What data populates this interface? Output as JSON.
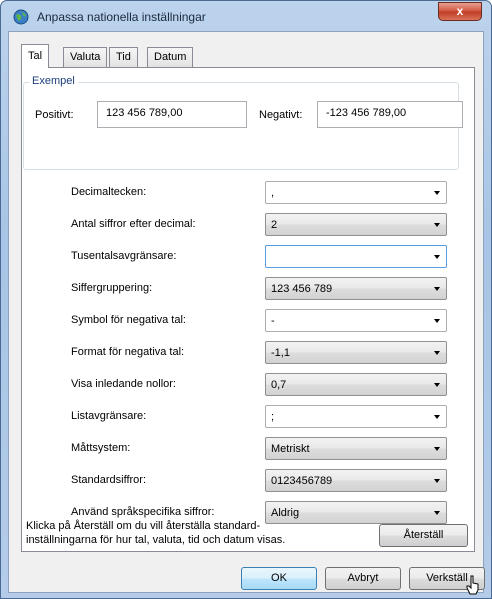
{
  "window": {
    "title": "Anpassa nationella inställningar",
    "close_label": "x"
  },
  "tabs": [
    "Tal",
    "Valuta",
    "Tid",
    "Datum"
  ],
  "example": {
    "legend": "Exempel",
    "positive_label": "Positivt:",
    "positive_value": "123 456 789,00",
    "negative_label": "Negativt:",
    "negative_value": "-123 456 789,00"
  },
  "settings": [
    {
      "label": "Decimaltecken:",
      "value": ","
    },
    {
      "label": "Antal siffror efter decimal:",
      "value": "2"
    },
    {
      "label": "Tusentalsavgränsare:",
      "value": ""
    },
    {
      "label": "Siffergruppering:",
      "value": "123 456 789"
    },
    {
      "label": "Symbol för negativa tal:",
      "value": "-"
    },
    {
      "label": "Format för negativa tal:",
      "value": "-1,1"
    },
    {
      "label": "Visa inledande nollor:",
      "value": "0,7"
    },
    {
      "label": "Listavgränsare:",
      "value": ";"
    },
    {
      "label": "Måttsystem:",
      "value": "Metriskt"
    },
    {
      "label": "Standardsiffror:",
      "value": "0123456789"
    },
    {
      "label": "Använd språkspecifika siffror:",
      "value": "Aldrig"
    }
  ],
  "info": {
    "text_line1": "Klicka på Återställ om du vill återställa standard-",
    "text_line2": "inställningarna för hur tal, valuta, tid och datum visas.",
    "reset_label": "Återställ"
  },
  "footer": {
    "ok_label": "OK",
    "cancel_label": "Avbryt",
    "apply_label": "Verkställ"
  }
}
